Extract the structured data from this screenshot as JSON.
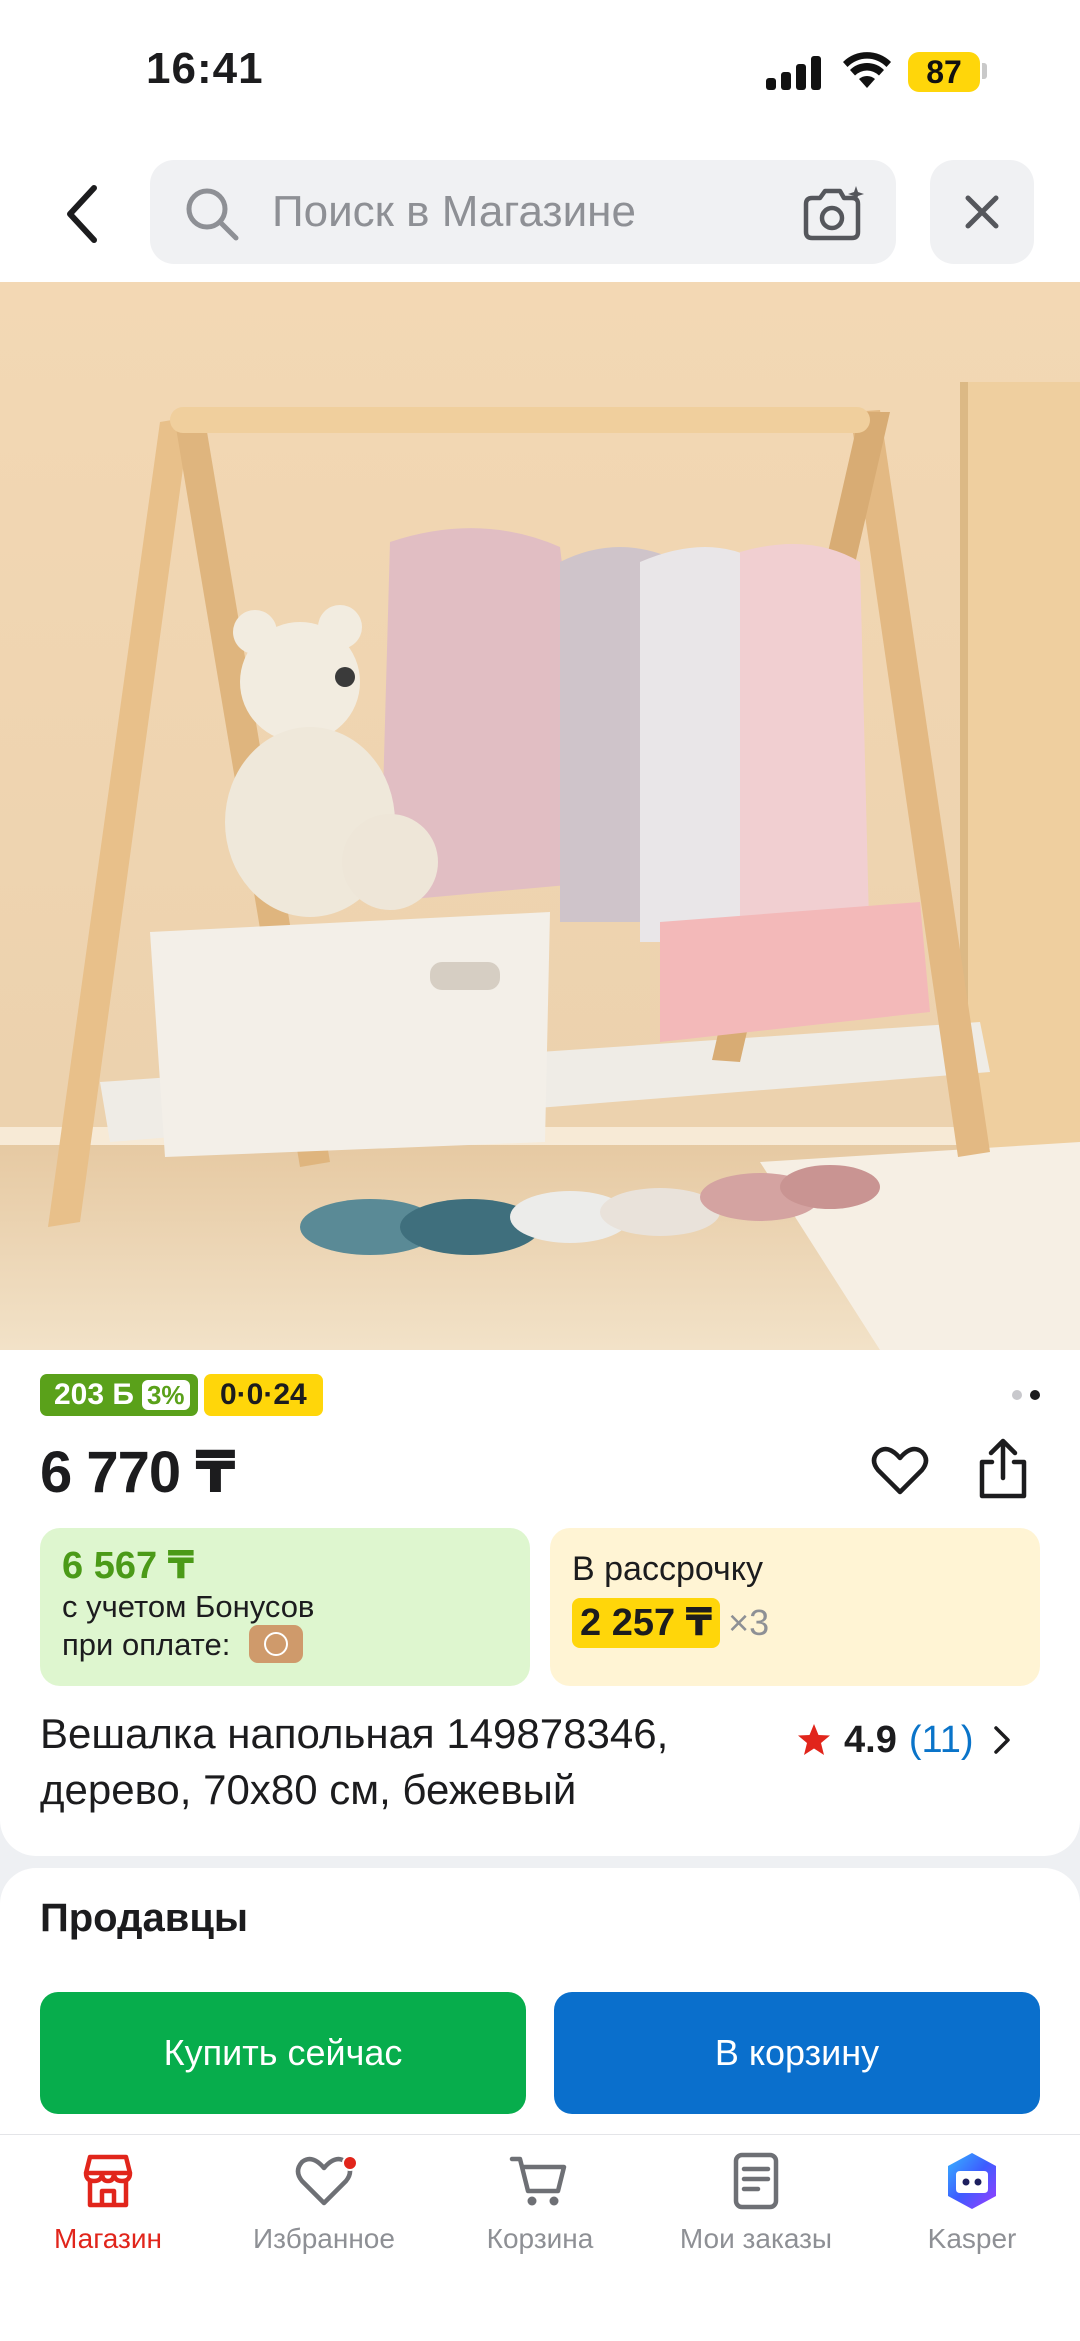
{
  "status_bar": {
    "time": "16:41",
    "battery": "87"
  },
  "search": {
    "placeholder": "Поиск в Магазине"
  },
  "product": {
    "bonus_badge": "203 Б",
    "bonus_percent": "3%",
    "installment_badge": "0·0·24",
    "image_count": 2,
    "image_active_index": 1,
    "price": "6 770 ₸",
    "bonus_price": "6 567 ₸",
    "bonus_text_1": "с учетом Бонусов",
    "bonus_text_2": "при оплате:",
    "installment_label": "В рассрочку",
    "installment_amount": "2 257 ₸",
    "installment_times": "×3",
    "title": "Вешалка напольная 149878346, дерево, 70х80 см, бежевый",
    "rating": "4.9",
    "reviews": "(11)"
  },
  "sellers": {
    "title": "Продавцы",
    "buy_now": "Купить сейчас",
    "add_to_cart": "В корзину"
  },
  "nav": {
    "items": [
      {
        "label": "Магазин",
        "icon": "shop-icon",
        "active": true
      },
      {
        "label": "Избранное",
        "icon": "heart-icon",
        "badge": true
      },
      {
        "label": "Корзина",
        "icon": "cart-icon"
      },
      {
        "label": "Мои заказы",
        "icon": "orders-icon"
      },
      {
        "label": "Kasper",
        "icon": "kasper-icon"
      }
    ]
  },
  "colors": {
    "brand_red": "#e1251b",
    "bonus_green": "#5aa11a",
    "buy_green": "#07ad4c",
    "cart_blue": "#0a6fcc",
    "installment_yellow": "#ffd60a"
  }
}
